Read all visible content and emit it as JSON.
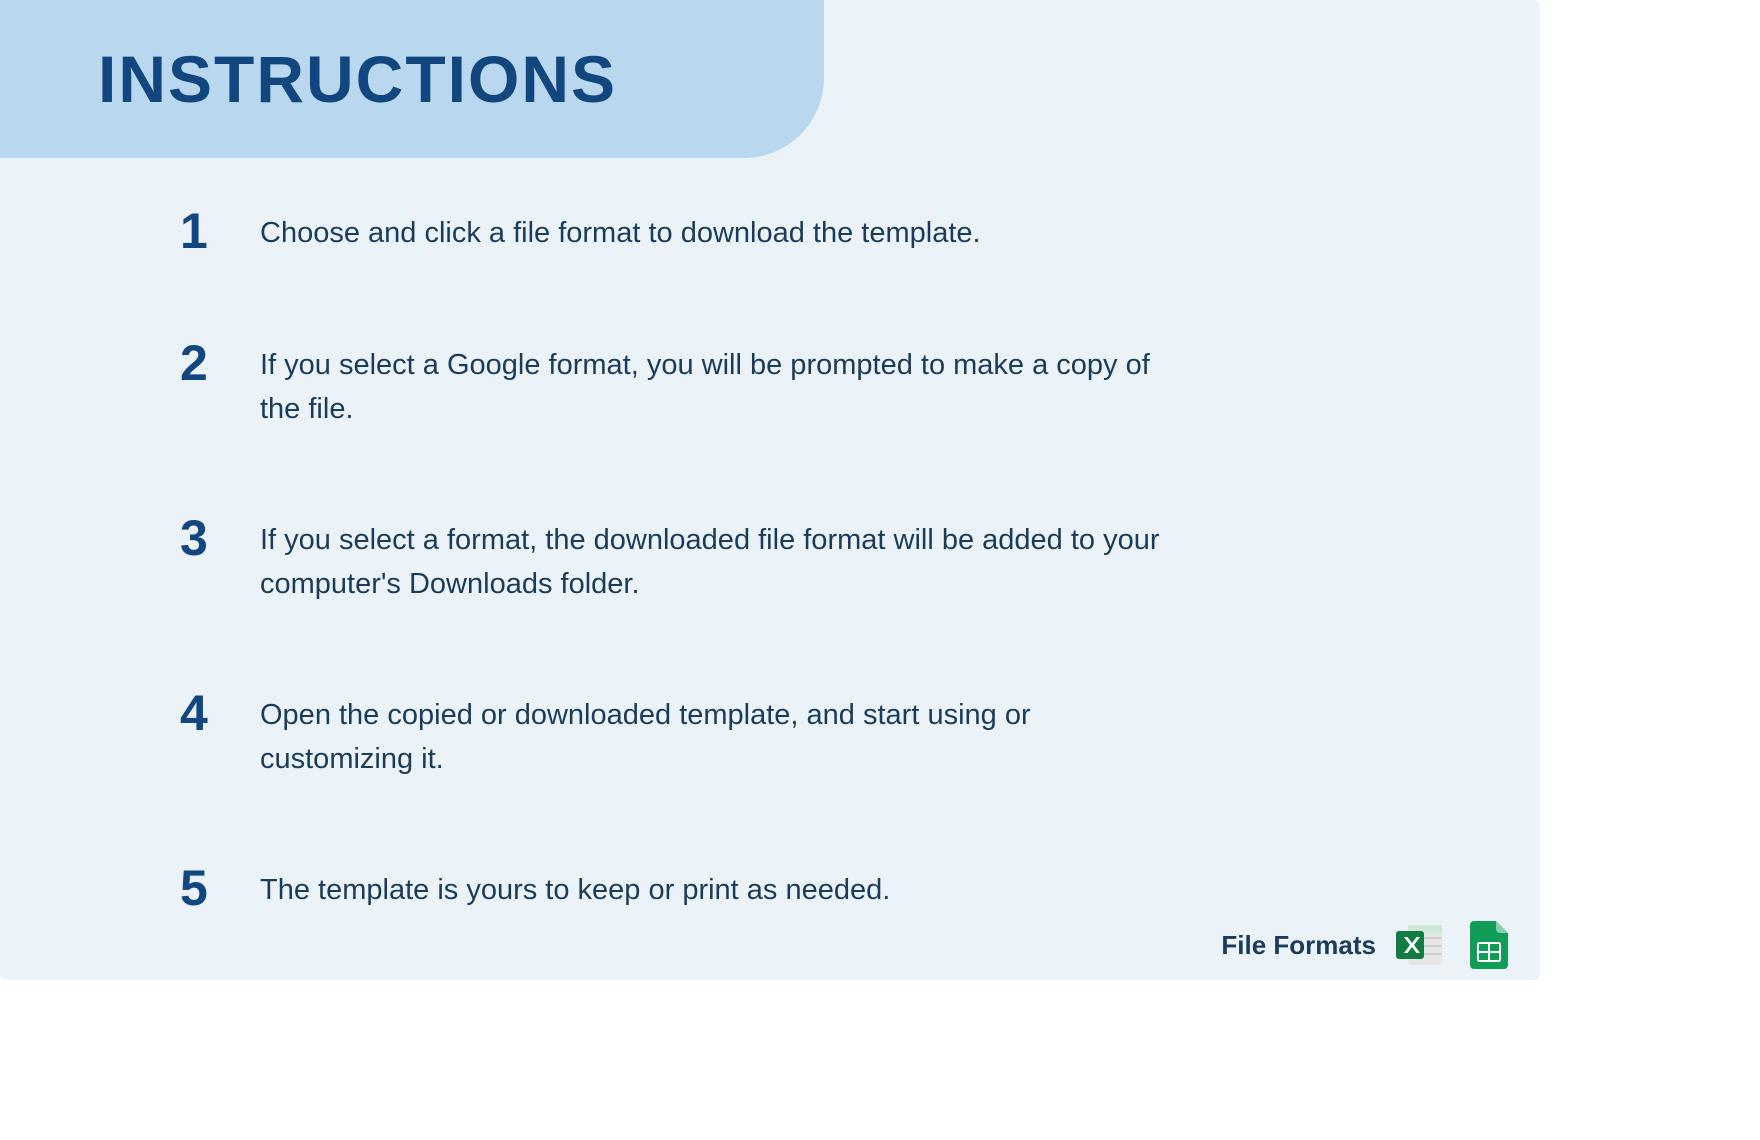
{
  "header": {
    "title": "INSTRUCTIONS"
  },
  "steps": [
    {
      "num": "1",
      "text": "Choose and click a file format to download the template."
    },
    {
      "num": "2",
      "text": "If you select a Google format, you will be prompted to make a copy of the file."
    },
    {
      "num": "3",
      "text": "If you select a format, the downloaded file format will be added to your computer's Downloads folder."
    },
    {
      "num": "4",
      "text": "Open the copied or downloaded template, and start using or customizing it."
    },
    {
      "num": "5",
      "text": "The template is yours to keep or print as needed."
    }
  ],
  "footer": {
    "label": "File Formats",
    "formats": [
      "excel",
      "google-sheets"
    ]
  },
  "colors": {
    "accent": "#12467f",
    "band": "#b9d7ef",
    "card": "#ebf3f9",
    "text": "#1a3b5a",
    "excel": "#107c41",
    "gsheet": "#0f9d58"
  }
}
